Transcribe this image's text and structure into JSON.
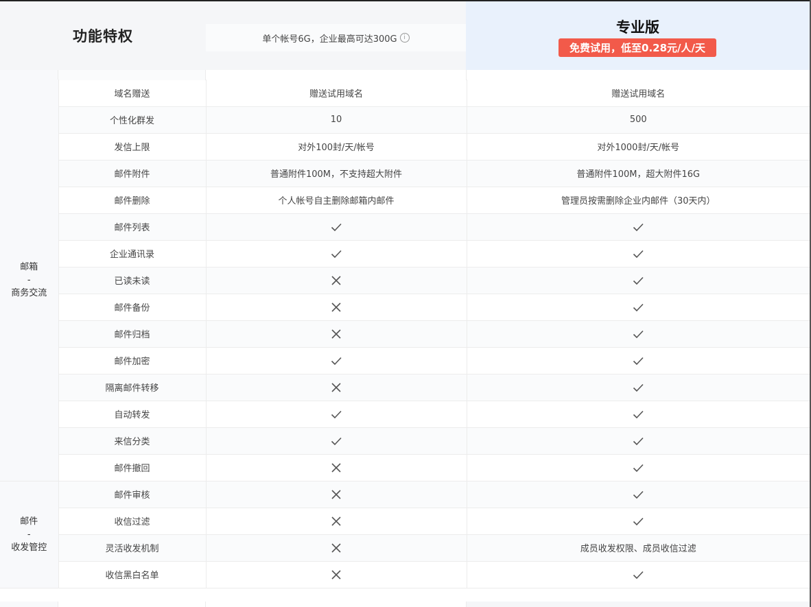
{
  "header": {
    "features_title": "功能特权",
    "basic_desc": "单个帐号6G，企业最高可达300G",
    "basic_info_icon": "info-circle-icon",
    "pro_title": "专业版",
    "pro_promo": "免费试用，低至0.28元/人/天"
  },
  "colors": {
    "promo_bg": "#f25a4a",
    "pro_header_bg": "#e9f1fc",
    "header_bg": "#f5f6f8"
  },
  "groups": [
    {
      "category_lines": [
        "邮箱",
        "-",
        "商务交流"
      ],
      "rows": [
        {
          "feature": "域名赠送",
          "basic": "赠送试用域名",
          "pro": "赠送试用域名"
        },
        {
          "feature": "个性化群发",
          "basic": "10",
          "pro": "500"
        },
        {
          "feature": "发信上限",
          "basic": "对外100封/天/帐号",
          "pro": "对外1000封/天/帐号"
        },
        {
          "feature": "邮件附件",
          "basic": "普通附件100M，不支持超大附件",
          "pro": "普通附件100M，超大附件16G"
        },
        {
          "feature": "邮件删除",
          "basic": "个人帐号自主删除邮箱内邮件",
          "pro": "管理员按需删除企业内邮件（30天内）"
        },
        {
          "feature": "邮件列表",
          "basic": "check",
          "pro": "check"
        },
        {
          "feature": "企业通讯录",
          "basic": "check",
          "pro": "check"
        },
        {
          "feature": "已读未读",
          "basic": "cross",
          "pro": "check"
        },
        {
          "feature": "邮件备份",
          "basic": "cross",
          "pro": "check"
        },
        {
          "feature": "邮件归档",
          "basic": "cross",
          "pro": "check"
        },
        {
          "feature": "邮件加密",
          "basic": "check",
          "pro": "check"
        },
        {
          "feature": "隔离邮件转移",
          "basic": "cross",
          "pro": "check"
        },
        {
          "feature": "自动转发",
          "basic": "check",
          "pro": "check"
        },
        {
          "feature": "来信分类",
          "basic": "check",
          "pro": "check"
        },
        {
          "feature": "邮件撤回",
          "basic": "cross",
          "pro": "check"
        }
      ]
    },
    {
      "category_lines": [
        "邮件",
        "-",
        "收发管控"
      ],
      "rows": [
        {
          "feature": "邮件审核",
          "basic": "cross",
          "pro": "check"
        },
        {
          "feature": "收信过滤",
          "basic": "cross",
          "pro": "check"
        },
        {
          "feature": "灵活收发机制",
          "basic": "cross",
          "pro": "成员收发权限、成员收信过滤"
        },
        {
          "feature": "收信黑白名单",
          "basic": "cross",
          "pro": "check"
        }
      ]
    }
  ]
}
